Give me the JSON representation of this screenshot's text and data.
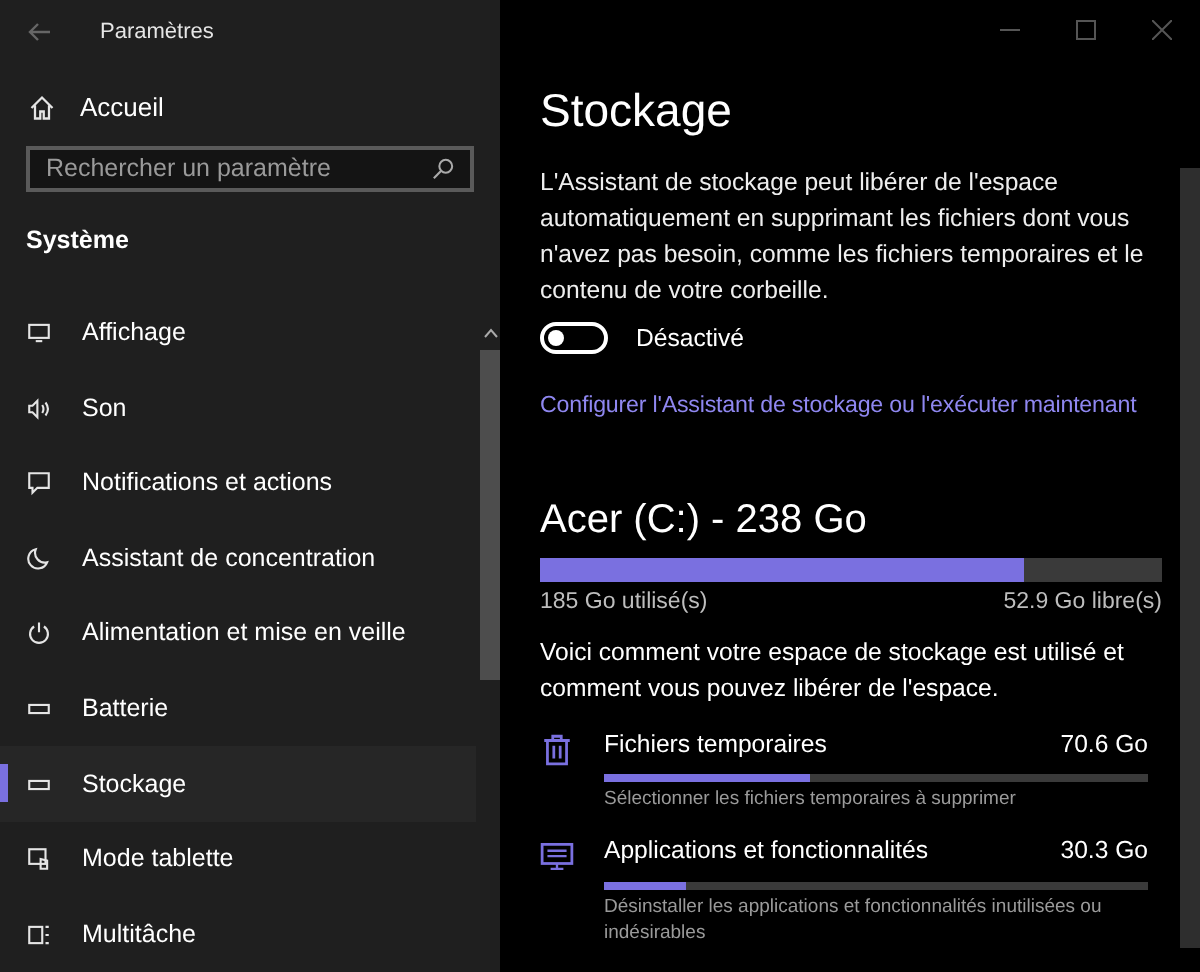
{
  "window": {
    "title": "Paramètres"
  },
  "sidebar": {
    "home": "Accueil",
    "search": {
      "placeholder": "Rechercher un paramètre"
    },
    "section": "Système",
    "items": [
      {
        "kind": "display",
        "label": "Affichage",
        "selected": false
      },
      {
        "kind": "sound",
        "label": "Son",
        "selected": false
      },
      {
        "kind": "notifications",
        "label": "Notifications et actions",
        "selected": false
      },
      {
        "kind": "focus",
        "label": "Assistant de concentration",
        "selected": false
      },
      {
        "kind": "power",
        "label": "Alimentation et mise en veille",
        "selected": false
      },
      {
        "kind": "battery",
        "label": "Batterie",
        "selected": false
      },
      {
        "kind": "storage",
        "label": "Stockage",
        "selected": true
      },
      {
        "kind": "tablet",
        "label": "Mode tablette",
        "selected": false
      },
      {
        "kind": "multitask",
        "label": "Multitâche",
        "selected": false
      }
    ]
  },
  "main": {
    "title": "Stockage",
    "description": "L'Assistant de stockage peut libérer de l'espace automatiquement en supprimant les fichiers dont vous n'avez pas besoin, comme les fichiers temporaires et le contenu de votre corbeille.",
    "toggle": {
      "on": false,
      "label": "Désactivé"
    },
    "link": "Configurer l'Assistant de stockage ou l'exécuter maintenant",
    "drive": {
      "title": "Acer (C:) - 238 Go",
      "level": 0.777,
      "used": "185 Go utilisé(s)",
      "free": "52.9 Go libre(s)"
    },
    "summary": "Voici comment votre espace de stockage est utilisé et comment vous pouvez libérer de l'espace.",
    "categories": [
      {
        "kind": "trash",
        "name": "Fichiers temporaires",
        "size": "70.6 Go",
        "level": 0.38,
        "hint": "Sélectionner les fichiers temporaires à supprimer"
      },
      {
        "kind": "apps",
        "name": "Applications et fonctionnalités",
        "size": "30.3 Go",
        "level": 0.15,
        "hint": "Désinstaller les applications et fonctionnalités inutilisées ou indésirables"
      }
    ]
  }
}
